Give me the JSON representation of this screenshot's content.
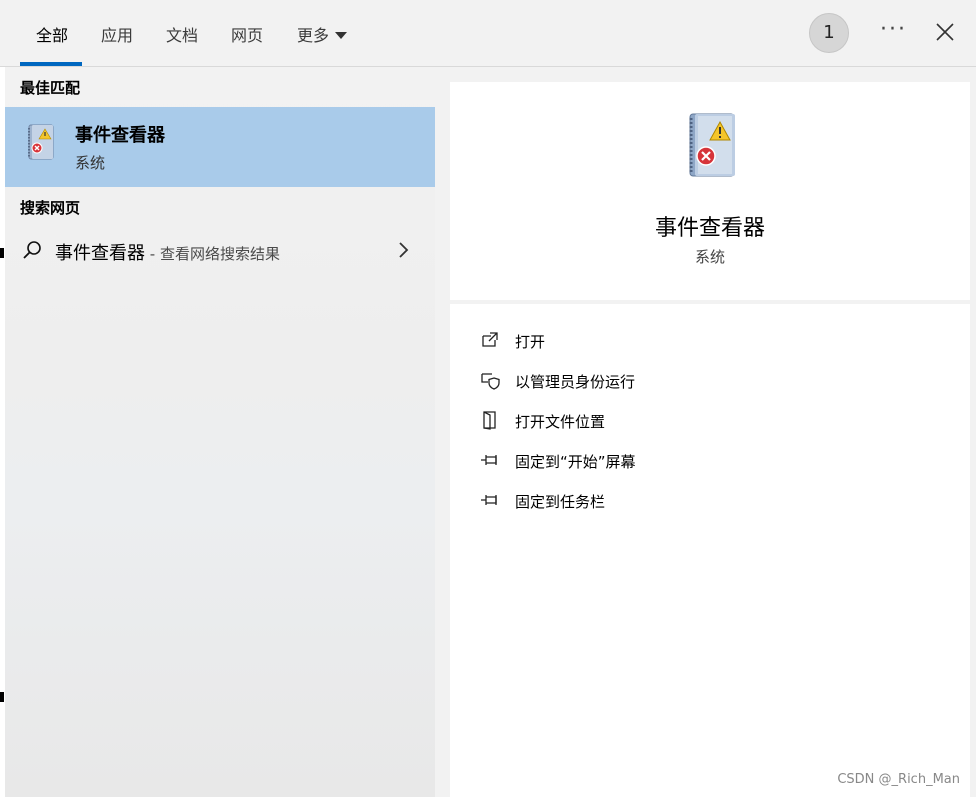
{
  "tabs": [
    {
      "label": "全部",
      "active": true
    },
    {
      "label": "应用"
    },
    {
      "label": "文档"
    },
    {
      "label": "网页"
    },
    {
      "label": "更多"
    }
  ],
  "header": {
    "avatar_text": "1",
    "more_options": "···"
  },
  "best_match": {
    "section_title": "最佳匹配",
    "title": "事件查看器",
    "subtitle": "系统",
    "icon": "event-viewer-icon"
  },
  "web_search": {
    "section_title": "搜索网页",
    "query": "事件查看器",
    "suffix": " - 查看网络搜索结果"
  },
  "detail": {
    "title": "事件查看器",
    "subtitle": "系统",
    "actions": [
      {
        "label": "打开",
        "icon": "open-external-icon"
      },
      {
        "label": "以管理员身份运行",
        "icon": "admin-shield-icon"
      },
      {
        "label": "打开文件位置",
        "icon": "file-location-icon"
      },
      {
        "label": "固定到“开始”屏幕",
        "icon": "pin-icon"
      },
      {
        "label": "固定到任务栏",
        "icon": "pin-icon"
      }
    ]
  },
  "watermark": "CSDN @_Rich_Man",
  "colors": {
    "accent": "#0067c0",
    "selected": "#a9cbea"
  }
}
